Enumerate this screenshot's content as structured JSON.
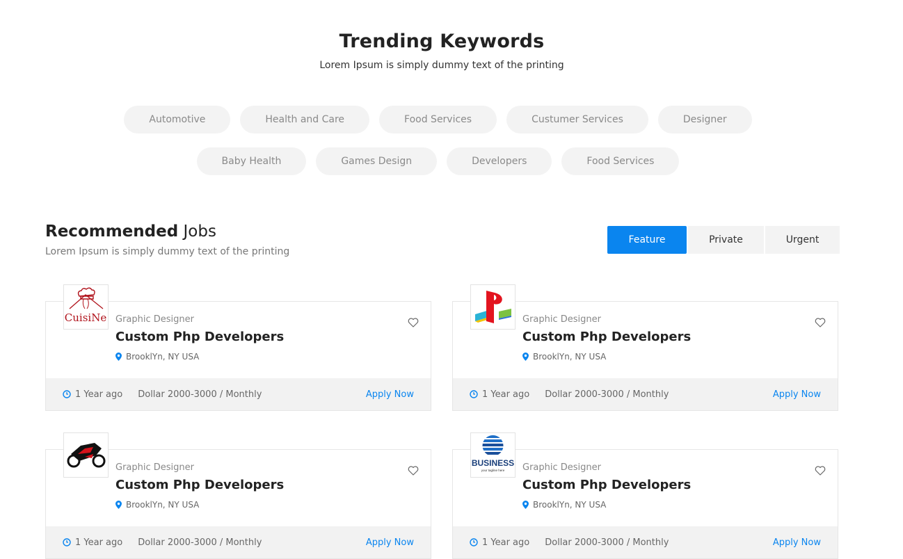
{
  "trending": {
    "title": "Trending Keywords",
    "subtitle": "Lorem Ipsum is simply dummy text of the printing",
    "row1": [
      "Automotive",
      "Health and Care",
      "Food Services",
      "Custumer Services",
      "Designer"
    ],
    "row2": [
      "Baby Health",
      "Games Design",
      "Developers",
      "Food Services"
    ]
  },
  "recommended": {
    "title_bold": "Recommended",
    "title_rest": " Jobs",
    "subtitle": "Lorem Ipsum is simply dummy text of the printing",
    "tabs": [
      "Feature",
      "Private",
      "Urgent"
    ],
    "active_tab": "Feature"
  },
  "accent_color": "#0a85ef",
  "jobs": [
    {
      "logo": "cuisine-logo",
      "logo_text": "CuisiNe",
      "category": "Graphic Designer",
      "title": "Custom Php Developers",
      "location": "BrooklYn, NY USA",
      "posted": "1 Year ago",
      "salary": "Dollar 2000-3000 / Monthly",
      "apply": "Apply Now"
    },
    {
      "logo": "playstation-logo",
      "category": "Graphic Designer",
      "title": "Custom Php Developers",
      "location": "BrooklYn, NY USA",
      "posted": "1 Year ago",
      "salary": "Dollar 2000-3000 / Monthly",
      "apply": "Apply Now"
    },
    {
      "logo": "motorbike-logo",
      "category": "Graphic Designer",
      "title": "Custom Php Developers",
      "location": "BrooklYn, NY USA",
      "posted": "1 Year ago",
      "salary": "Dollar 2000-3000 / Monthly",
      "apply": "Apply Now"
    },
    {
      "logo": "business-logo",
      "logo_text": "BUSINESS",
      "logo_tagline": "your tagline here",
      "category": "Graphic Designer",
      "title": "Custom Php Developers",
      "location": "BrooklYn, NY USA",
      "posted": "1 Year ago",
      "salary": "Dollar 2000-3000 / Monthly",
      "apply": "Apply Now"
    }
  ]
}
